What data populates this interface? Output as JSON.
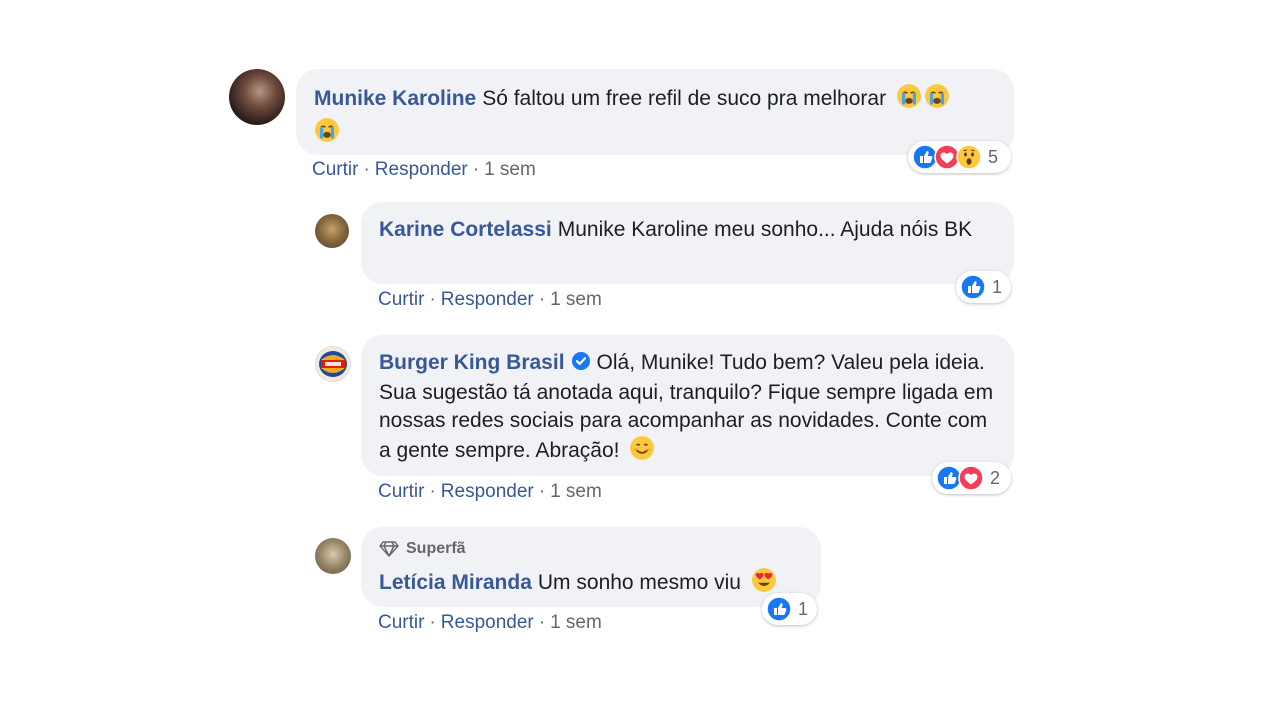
{
  "comments": [
    {
      "author": "Munike Karoline",
      "text": "Só faltou um free refil de suco pra melhorar",
      "actions": {
        "like": "Curtir",
        "reply": "Responder",
        "time": "1 sem"
      },
      "reaction_types": [
        "like-icon",
        "love-icon",
        "wow-icon"
      ],
      "reaction_count": "5"
    },
    {
      "author": "Karine Cortelassi",
      "text": "Munike Karoline meu sonho... Ajuda nóis BK",
      "actions": {
        "like": "Curtir",
        "reply": "Responder",
        "time": "1 sem"
      },
      "reaction_types": [
        "like-icon"
      ],
      "reaction_count": "1"
    },
    {
      "author": "Burger King Brasil",
      "verified": true,
      "text": "Olá, Munike! Tudo bem? Valeu pela ideia. Sua sugestão tá anotada aqui, tranquilo? Fique sempre ligada em nossas redes sociais para acompanhar as novidades. Conte com a gente sempre. Abração!",
      "actions": {
        "like": "Curtir",
        "reply": "Responder",
        "time": "1 sem"
      },
      "reaction_types": [
        "like-icon",
        "love-icon"
      ],
      "reaction_count": "2"
    },
    {
      "badge": "Superfã",
      "author": "Letícia Miranda",
      "text": "Um sonho mesmo viu",
      "actions": {
        "like": "Curtir",
        "reply": "Responder",
        "time": "1 sem"
      },
      "reaction_types": [
        "like-icon"
      ],
      "reaction_count": "1"
    }
  ],
  "separator": "·",
  "colors": {
    "link": "#385898",
    "bubble": "#f0f2f5",
    "like": "#1877f2",
    "love": "#f33e58",
    "wow": "#fcc93d",
    "meta": "#65676b"
  }
}
